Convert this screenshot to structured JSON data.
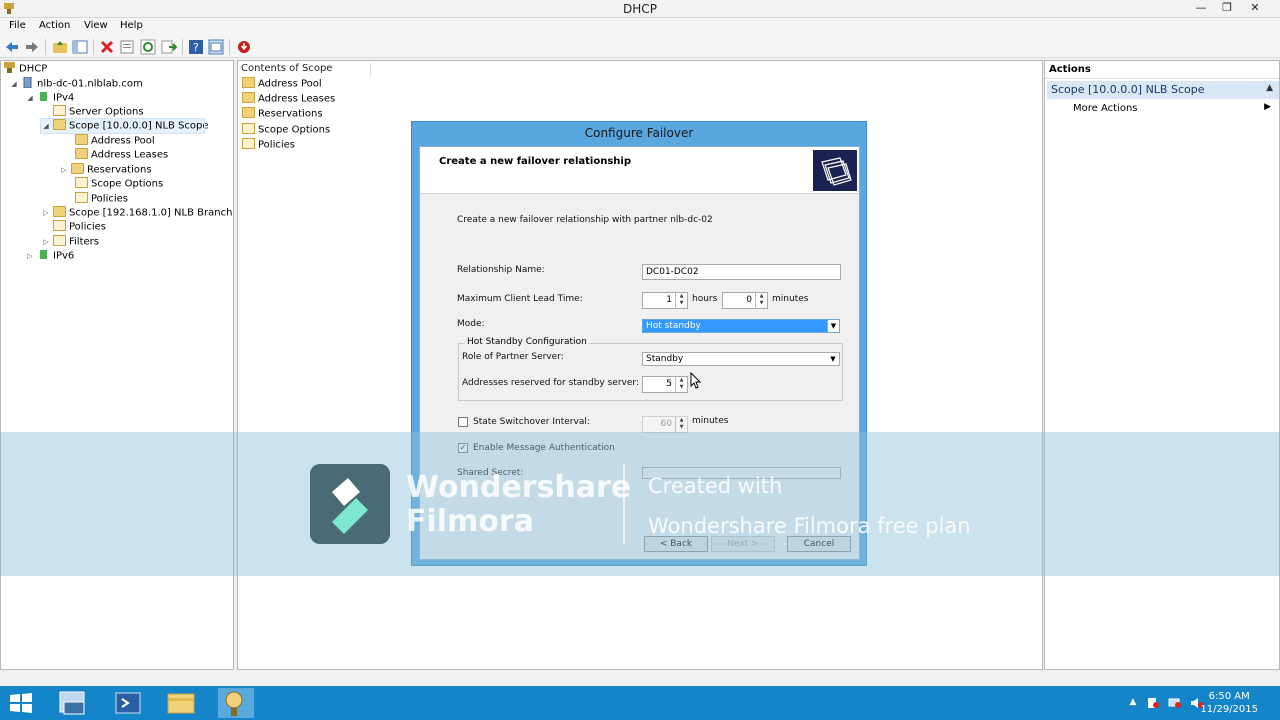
{
  "window": {
    "title": "DHCP"
  },
  "menu": [
    "File",
    "Action",
    "View",
    "Help"
  ],
  "tree": {
    "items": [
      {
        "label": "DHCP"
      },
      {
        "label": "nlb-dc-01.nlblab.com"
      },
      {
        "label": "IPv4"
      },
      {
        "label": "Server Options"
      },
      {
        "label": "Scope [10.0.0.0] NLB Scope"
      },
      {
        "label": "Address Pool"
      },
      {
        "label": "Address Leases"
      },
      {
        "label": "Reservations"
      },
      {
        "label": "Scope Options"
      },
      {
        "label": "Policies"
      },
      {
        "label": "Scope [192.168.1.0] NLB Branch"
      },
      {
        "label": "Policies"
      },
      {
        "label": "Filters"
      },
      {
        "label": "IPv6"
      }
    ]
  },
  "contents": {
    "header": "Contents of Scope",
    "items": [
      "Address Pool",
      "Address Leases",
      "Reservations",
      "Scope Options",
      "Policies"
    ]
  },
  "actions": {
    "header": "Actions",
    "scope": "Scope [10.0.0.0] NLB Scope",
    "more": "More Actions"
  },
  "dialog": {
    "title": "Configure Failover",
    "heading": "Create a new failover relationship",
    "intro": "Create a new failover relationship with partner nlb-dc-02",
    "relationship_label": "Relationship Name:",
    "relationship_value": "DC01-DC02",
    "mclt_label": "Maximum Client Lead Time:",
    "mclt_hours": "1",
    "hours_label": "hours",
    "mclt_minutes": "0",
    "minutes_label": "minutes",
    "mode_label": "Mode:",
    "mode_value": "Hot standby",
    "group_title": "Hot Standby Configuration",
    "role_label": "Role of Partner Server:",
    "role_value": "Standby",
    "reserved_label": "Addresses reserved for standby server:",
    "reserved_value": "5",
    "switchover_label": "State Switchover Interval:",
    "switchover_value": "60",
    "switchover_minutes": "minutes",
    "auth_label": "Enable Message Authentication",
    "secret_label": "Shared Secret:",
    "back": "< Back",
    "next": "Next >",
    "cancel": "Cancel"
  },
  "watermark": {
    "brand_line1": "Wondershare",
    "brand_line2": "Filmora",
    "created": "Created with",
    "plan": "Wondershare Filmora free plan"
  },
  "taskbar": {
    "time": "6:50 AM",
    "date": "11/29/2015"
  }
}
